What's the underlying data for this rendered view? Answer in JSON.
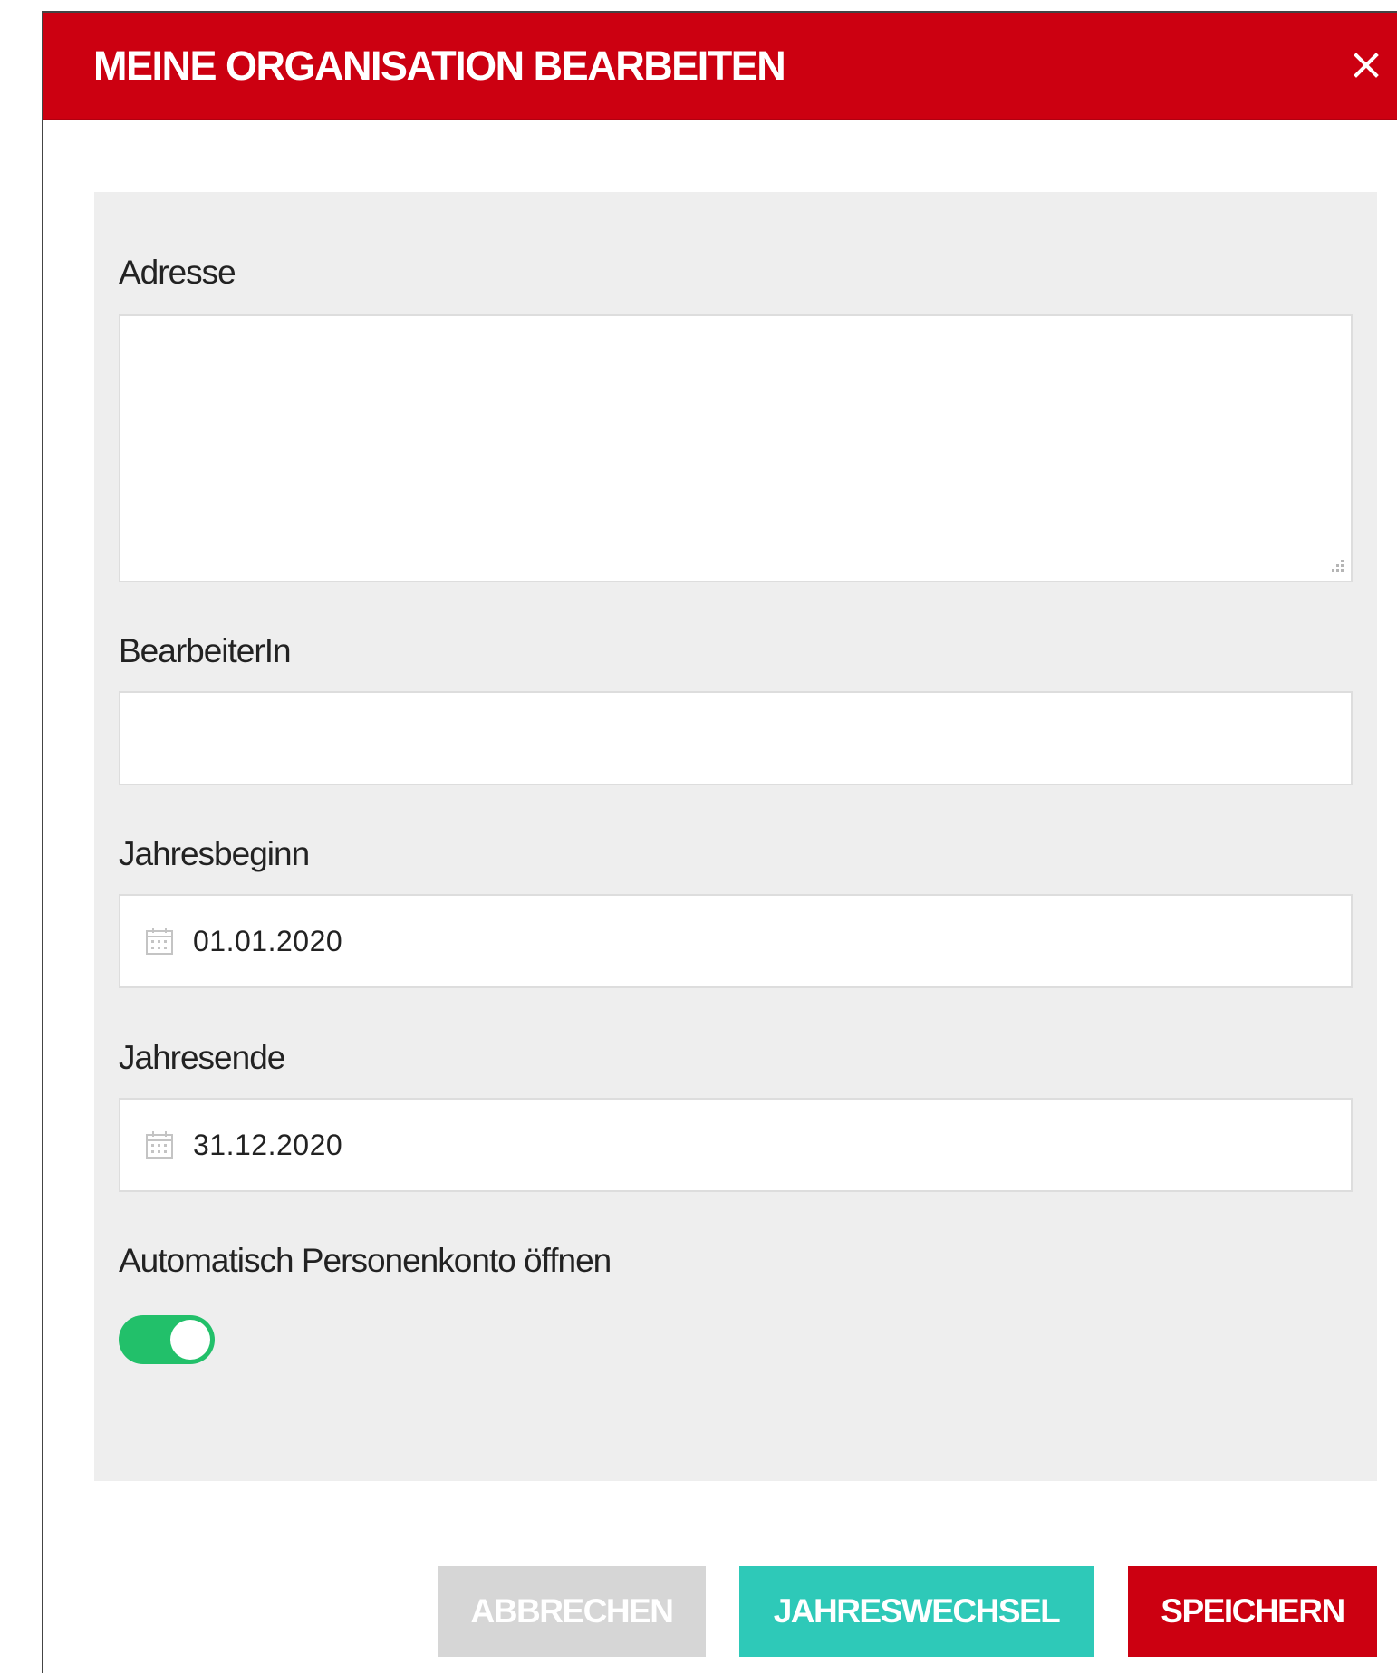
{
  "dialog": {
    "title": "MEINE ORGANISATION BEARBEITEN",
    "close_icon": "close-icon"
  },
  "form": {
    "address": {
      "label": "Adresse",
      "value": ""
    },
    "editor": {
      "label": "BearbeiterIn",
      "value": ""
    },
    "year_start": {
      "label": "Jahresbeginn",
      "value": "01.01.2020",
      "icon": "calendar-icon"
    },
    "year_end": {
      "label": "Jahresende",
      "value": "31.12.2020",
      "icon": "calendar-icon"
    },
    "auto_account": {
      "label": "Automatisch Personenkonto öffnen",
      "enabled": true
    }
  },
  "actions": {
    "cancel_label": "ABBRECHEN",
    "year_change_label": "JAHRESWECHSEL",
    "save_label": "SPEICHERN"
  },
  "colors": {
    "header": "#cc0011",
    "toggle_on": "#22c06a",
    "year_change_button": "#2ec9b8",
    "save_button": "#cc0011",
    "cancel_button_disabled": "#d6d6d6",
    "panel_background": "#eeeeee"
  }
}
